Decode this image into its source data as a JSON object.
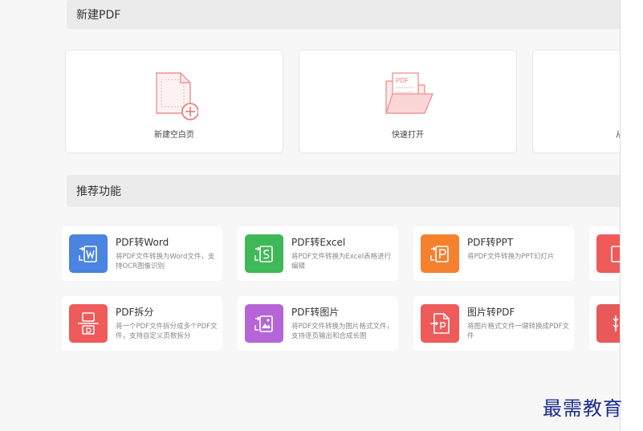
{
  "sections": {
    "new_pdf_title": "新建PDF",
    "recommended_title": "推荐功能"
  },
  "new_cards": [
    {
      "label": "新建空白页",
      "icon": "blank-page-plus-icon"
    },
    {
      "label": "快速打开",
      "icon": "folder-pdf-icon"
    },
    {
      "label": "从",
      "icon": "partial-card-icon"
    }
  ],
  "features": [
    {
      "title": "PDF转Word",
      "desc": "将PDF文件转换为Word文件，支持OCR图像识别",
      "color": "#4a84e0",
      "icon": "word-convert-icon"
    },
    {
      "title": "PDF转Excel",
      "desc": "将PDF文件转换为Excel表格进行编辑",
      "color": "#3fb858",
      "icon": "excel-convert-icon"
    },
    {
      "title": "PDF转PPT",
      "desc": "将PDF文件转换为PPT幻灯片",
      "color": "#f5812e",
      "icon": "ppt-convert-icon"
    },
    {
      "title": "PDF拆分",
      "desc": "将一个PDF文件拆分成多个PDF文件，支持自定义页数拆分",
      "color": "#ef5a5a",
      "icon": "split-icon"
    },
    {
      "title": "PDF转图片",
      "desc": "将PDF文件转换为图片格式文件，支持逐页输出和合成长图",
      "color": "#b565d8",
      "icon": "image-convert-icon"
    },
    {
      "title": "图片转PDF",
      "desc": "将图片格式文件一键转换成PDF文件",
      "color": "#ef5a5a",
      "icon": "image-to-pdf-icon"
    }
  ],
  "partial_features": [
    {
      "color": "#ef5a5a",
      "icon": "partial-feature-icon"
    },
    {
      "color": "#e85a5a",
      "icon": "partial-feature-icon"
    }
  ],
  "watermark": "最需教育",
  "accent_color": "#f08c8c"
}
